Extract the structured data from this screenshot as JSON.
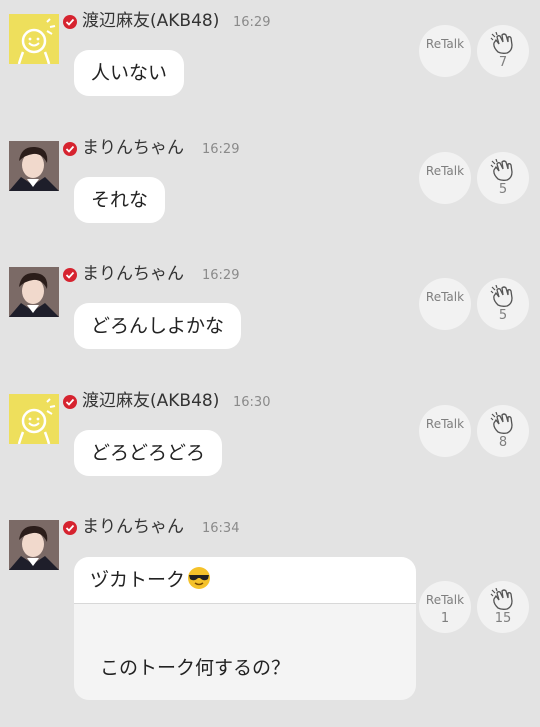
{
  "messages": [
    {
      "name": "渡辺麻友(AKB48)",
      "time": "16:29",
      "text": "人いない",
      "retalk": "ReTalk",
      "retalk_count": "",
      "claps": "7",
      "avatar": "yellow-smiley-avatar"
    },
    {
      "name": "まりんちゃん",
      "time": "16:29",
      "text": "それな",
      "retalk": "ReTalk",
      "retalk_count": "",
      "claps": "5",
      "avatar": "photo-avatar"
    },
    {
      "name": "まりんちゃん",
      "time": "16:29",
      "text": "どろんしよかな",
      "retalk": "ReTalk",
      "retalk_count": "",
      "claps": "5",
      "avatar": "photo-avatar"
    },
    {
      "name": "渡辺麻友(AKB48)",
      "time": "16:30",
      "text": "どろどろどろ",
      "retalk": "ReTalk",
      "retalk_count": "",
      "claps": "8",
      "avatar": "yellow-smiley-avatar"
    },
    {
      "name": "まりんちゃん",
      "time": "16:34",
      "title": "ヅカトーク",
      "title_icon": "sunglasses-emoji-icon",
      "body": "このトーク何するの？",
      "retalk": "ReTalk",
      "retalk_count": "1",
      "claps": "15",
      "avatar": "photo-avatar"
    }
  ],
  "colors": {
    "background": "#e3e3e3",
    "bubble": "#ffffff",
    "verified": "#d6232f",
    "avatar_yellow": "#eedf5c"
  }
}
